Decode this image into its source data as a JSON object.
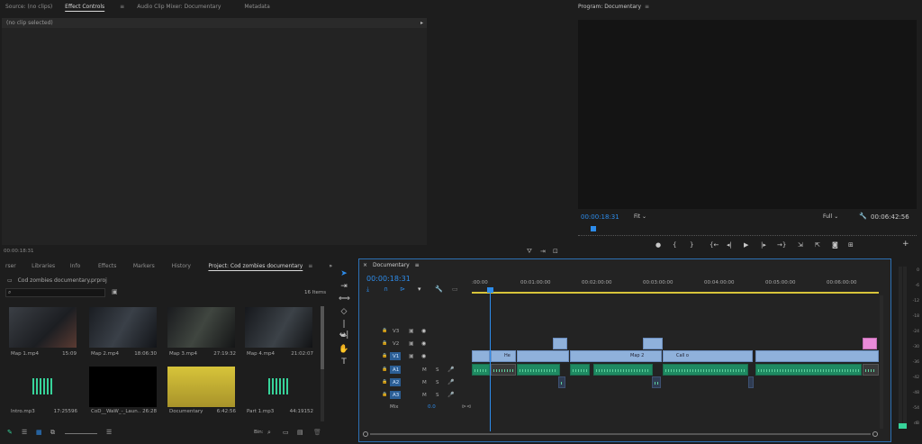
{
  "top_tabs": {
    "source": "Source: (no clips)",
    "effect_controls": "Effect Controls",
    "audio_mixer": "Audio Clip Mixer: Documentary",
    "metadata": "Metadata"
  },
  "effect_controls": {
    "status": "(no clip selected)",
    "timecode": "00:00:18:31"
  },
  "program": {
    "title": "Program: Documentary",
    "timecode": "00:00:18:31",
    "fit": "Fit",
    "quality": "Full",
    "duration": "00:06:42:56",
    "controls": [
      "●",
      "{",
      "}",
      "{←",
      "◂|",
      "◂",
      "▶",
      "|▸",
      "→}",
      "⇲",
      "⇱",
      "📷",
      "⊞",
      "+"
    ]
  },
  "project": {
    "tabs": [
      "rser",
      "Libraries",
      "Info",
      "Effects",
      "Markers",
      "History",
      "Project: Cod zombies documentary"
    ],
    "file": "Cod zombies documentary.prproj",
    "item_count": "16 Items",
    "search_placeholder": "",
    "bin_label": "Bin:",
    "items": [
      {
        "name": "Map 1.mp4",
        "duration": "15:09"
      },
      {
        "name": "Map 2.mp4",
        "duration": "18:06:30"
      },
      {
        "name": "Map 3.mp4",
        "duration": "27:19:32"
      },
      {
        "name": "Map 4.mp4",
        "duration": "21:02:07"
      },
      {
        "name": "Intro.mp3",
        "duration": "17:25596"
      },
      {
        "name": "CoD__WaW_-_Laun..",
        "duration": "26:28"
      },
      {
        "name": "Documentary",
        "duration": "6:42:56"
      },
      {
        "name": "Part 1.mp3",
        "duration": "44:19152"
      }
    ]
  },
  "timeline": {
    "sequence": "Documentary",
    "timecode": "00:00:18:31",
    "ruler": [
      ":00:00",
      "00:01:00:00",
      "00:02:00:00",
      "00:03:00:00",
      "00:04:00:00",
      "00:05:00:00",
      "00:06:00:00"
    ],
    "video_tracks": [
      "V3",
      "V2",
      "V1"
    ],
    "audio_tracks": [
      "A1",
      "A2",
      "A3"
    ],
    "mix_label": "Mix",
    "mix_value": "0.0",
    "clip_labels": [
      "He",
      "Map 2",
      "Call o"
    ]
  },
  "meter": {
    "ticks": [
      "0",
      "-6",
      "-12",
      "-18",
      "-24",
      "-30",
      "-36",
      "-42",
      "-48",
      "-54",
      "dB"
    ]
  },
  "colors": {
    "accent_blue": "#2d8ceb",
    "video_clip": "#8fb1db",
    "audio_clip": "#1f8a62",
    "pink_clip": "#e98ad8",
    "yellow_bar": "#d7c43a"
  }
}
